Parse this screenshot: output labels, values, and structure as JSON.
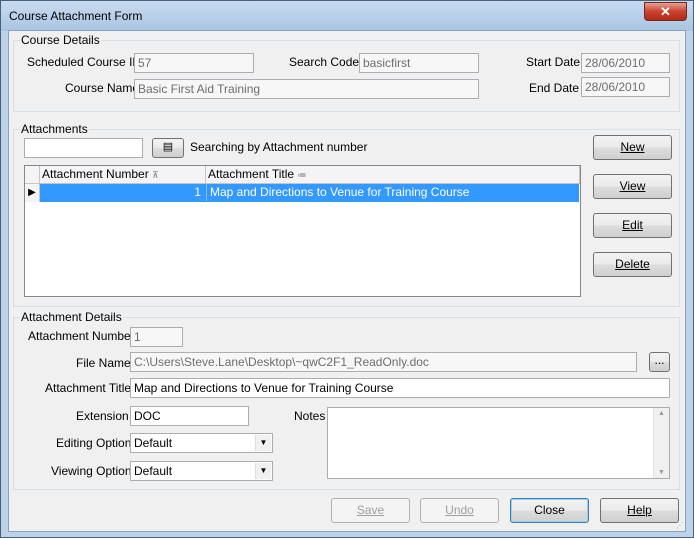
{
  "window": {
    "title": "Course Attachment Form",
    "close_glyph": "✕"
  },
  "course_details": {
    "legend": "Course Details",
    "scheduled_id_label": "Scheduled Course ID",
    "scheduled_id_value": "57",
    "search_code_label": "Search Code",
    "search_code_value": "basicfirst",
    "start_date_label": "Start Date",
    "start_date_value": "28/06/2010",
    "course_name_label": "Course Name",
    "course_name_value": "Basic First Aid Training",
    "end_date_label": "End Date",
    "end_date_value": "28/06/2010"
  },
  "attachments": {
    "legend": "Attachments",
    "search_value": "",
    "searching_text": "Searching by Attachment number",
    "columns": [
      "Attachment Number",
      "Attachment Title"
    ],
    "rows": [
      {
        "number": "1",
        "title": "Map and Directions to Venue for Training Course"
      }
    ],
    "buttons": {
      "new": "New",
      "view": "View",
      "edit": "Edit",
      "delete": "Delete"
    }
  },
  "attachment_details": {
    "legend": "Attachment Details",
    "number_label": "Attachment Number",
    "number_value": "1",
    "file_name_label": "File Name",
    "file_name_value": "C:\\Users\\Steve.Lane\\Desktop\\~qwC2F1_ReadOnly.doc",
    "browse_label": "...",
    "title_label": "Attachment Title",
    "title_value": "Map and Directions to Venue for Training Course",
    "extension_label": "Extension",
    "extension_value": "DOC",
    "notes_label": "Notes",
    "notes_value": "",
    "editing_label": "Editing Option",
    "editing_value": "Default",
    "viewing_label": "Viewing Option",
    "viewing_value": "Default"
  },
  "footer": {
    "save": "Save",
    "undo": "Undo",
    "close": "Close",
    "help": "Help"
  }
}
